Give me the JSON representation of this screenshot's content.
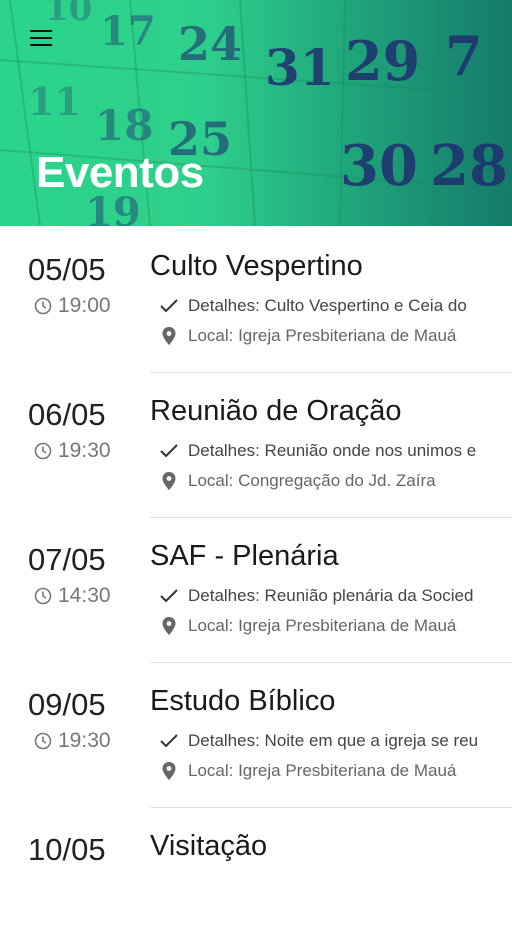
{
  "header": {
    "title": "Eventos",
    "menu_icon": "hamburger-menu-icon",
    "background": "calendar-photo-green-overlay"
  },
  "events": [
    {
      "date": "05/05",
      "time": "19:00",
      "name": "Culto Vespertino",
      "details": "Detalhes: Culto Vespertino e Ceia do",
      "location": "Local: Igreja Presbiteriana de Mauá"
    },
    {
      "date": "06/05",
      "time": "19:30",
      "name": "Reunião de Oração",
      "details": "Detalhes: Reunião onde nos unimos e",
      "location": "Local: Congregação do Jd. Zaíra"
    },
    {
      "date": "07/05",
      "time": "14:30",
      "name": "SAF - Plenária",
      "details": "Detalhes: Reunião plenária da Socied",
      "location": "Local: Igreja Presbiteriana de Mauá"
    },
    {
      "date": "09/05",
      "time": "19:30",
      "name": "Estudo Bíblico",
      "details": "Detalhes: Noite em que a igreja se reu",
      "location": "Local: Igreja Presbiteriana de Mauá"
    },
    {
      "date": "10/05",
      "time": "",
      "name": "Visitação",
      "details": "",
      "location": ""
    }
  ],
  "colors": {
    "accent": "#2bd489",
    "header_dark": "#157a6b",
    "calendar_numbers": "#1f2f6e"
  }
}
